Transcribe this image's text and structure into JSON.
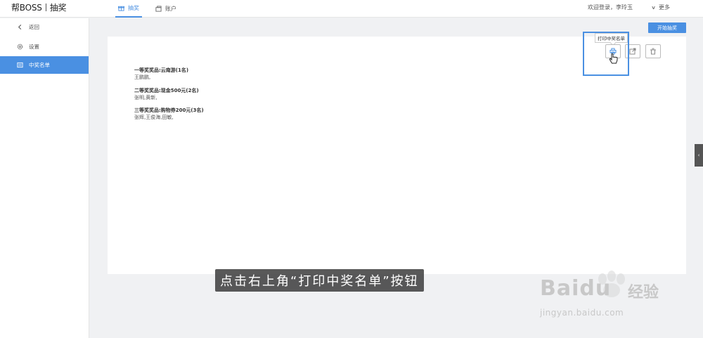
{
  "header": {
    "logo_brand": "帮BOSS",
    "logo_module": "抽奖",
    "tabs": [
      {
        "label": "抽奖",
        "active": true
      },
      {
        "label": "账户",
        "active": false
      }
    ],
    "welcome": "欢迎登录，李玲玉",
    "more": "更多"
  },
  "sidebar": {
    "items": [
      {
        "label": "返回",
        "icon": "chevron-left-icon"
      },
      {
        "label": "设置",
        "icon": "gear-icon"
      },
      {
        "label": "中奖名单",
        "icon": "list-icon",
        "active": true
      }
    ]
  },
  "main": {
    "start_button": "开始抽奖",
    "prizes": [
      {
        "title": "一等奖奖品:云南游(1名)",
        "winners": "王鹏鹏,"
      },
      {
        "title": "二等奖奖品:现金500元(2名)",
        "winners": "张明,黄新,"
      },
      {
        "title": "三等奖奖品:购物券200元(3名)",
        "winners": "张辉,王俊海,田敏,"
      }
    ],
    "tooltip": "打印中奖名单",
    "actions": [
      {
        "icon": "print-icon"
      },
      {
        "icon": "export-icon"
      },
      {
        "icon": "delete-icon"
      }
    ]
  },
  "caption": "点击右上角“打印中奖名单”按钮",
  "watermark": {
    "brand": "Baidu",
    "cn": "经验",
    "url": "jingyan.baidu.com"
  },
  "colors": {
    "accent": "#4a90e2",
    "sidebar_bg": "#ffffff",
    "page_bg": "#f0f1f3"
  }
}
